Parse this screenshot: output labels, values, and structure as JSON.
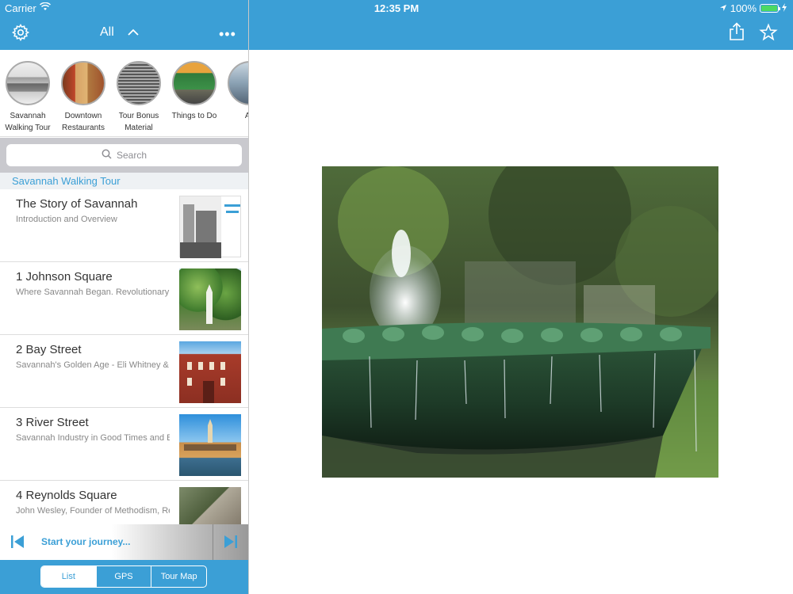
{
  "status": {
    "carrier": "Carrier",
    "time": "12:35 PM",
    "battery": "100%"
  },
  "nav": {
    "filter_label": "All",
    "more_label": "•••"
  },
  "categories": [
    {
      "label": "Savannah Walking Tour"
    },
    {
      "label": "Downtown Restaurants"
    },
    {
      "label": "Tour Bonus Material"
    },
    {
      "label": "Things to Do"
    },
    {
      "label": "Ab"
    }
  ],
  "search": {
    "placeholder": "Search"
  },
  "section": {
    "title": "Savannah Walking Tour"
  },
  "items": [
    {
      "title": "The Story of Savannah",
      "subtitle": "Introduction and Overview"
    },
    {
      "title": "1 Johnson Square",
      "subtitle": "Where Savannah Began. Revolutionary Gen"
    },
    {
      "title": "2 Bay Street",
      "subtitle": "Savannah's Golden Age - Eli Whitney & The C"
    },
    {
      "title": "3 River Street",
      "subtitle": "Savannah Industry in Good Times and Bad -"
    },
    {
      "title": "4 Reynolds Square",
      "subtitle": "John Wesley, Founder of Methodism, Revo"
    }
  ],
  "player": {
    "start_label": "Start your journey..."
  },
  "tabs": [
    {
      "label": "List"
    },
    {
      "label": "GPS"
    },
    {
      "label": "Tour Map"
    }
  ],
  "colors": {
    "accent": "#3b9fd6"
  }
}
